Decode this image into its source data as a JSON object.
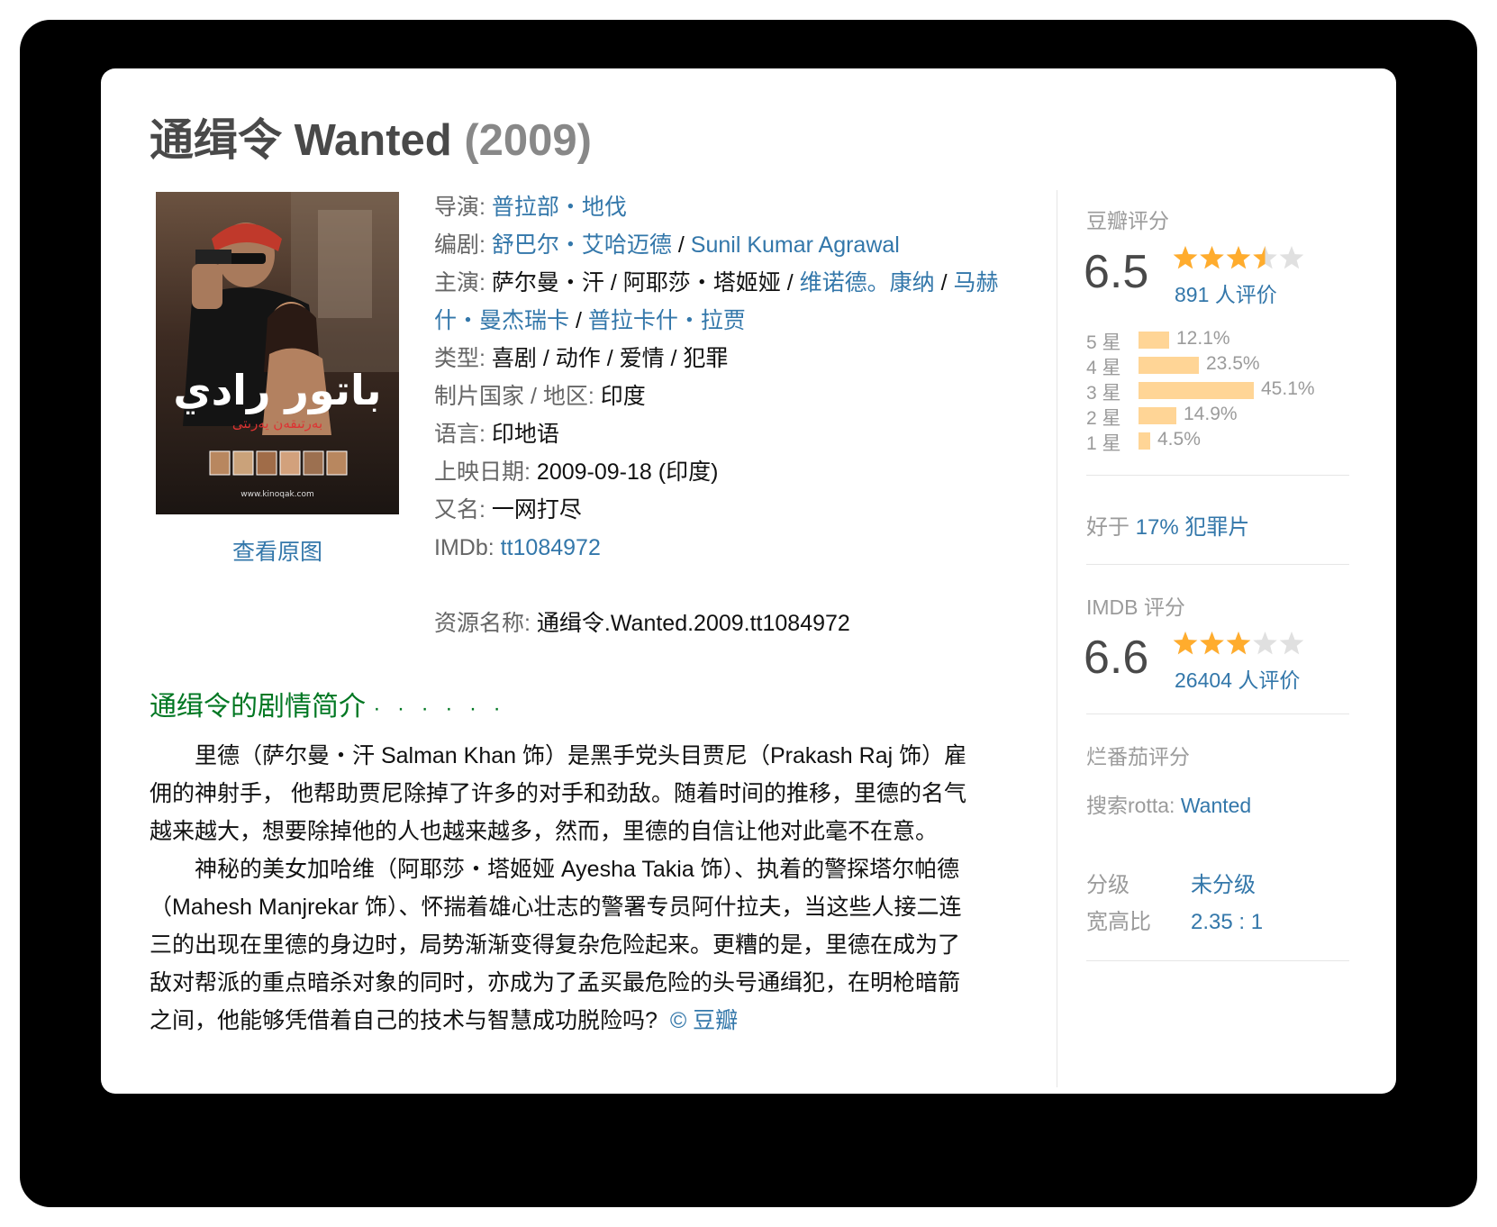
{
  "title": {
    "name": "通缉令 Wanted",
    "year": "(2009)"
  },
  "poster": {
    "view_original": "查看原图",
    "image_text": "www.kinoqak.com"
  },
  "info": {
    "director": {
      "label": "导演",
      "colon": ":",
      "names": [
        "普拉部・地伐"
      ]
    },
    "writer": {
      "label": "编剧",
      "colon": ":",
      "names": [
        "舒巴尔・艾哈迈德",
        "Sunil Kumar Agrawal"
      ]
    },
    "cast": {
      "label": "主演",
      "colon": ":",
      "names": [
        "萨尔曼・汗",
        "阿耶莎・塔姬娅",
        "维诺德。康纳",
        "马赫什・曼杰瑞卡",
        "普拉卡什・拉贾"
      ]
    },
    "genre": {
      "label": "类型",
      "colon": ":",
      "value": "喜剧 / 动作 / 爱情 / 犯罪"
    },
    "country": {
      "label": "制片国家 / 地区",
      "colon": ":",
      "value": "印度"
    },
    "language": {
      "label": "语言",
      "colon": ":",
      "value": "印地语"
    },
    "release": {
      "label": "上映日期",
      "colon": ":",
      "value": "2009-09-18 (印度)"
    },
    "aka": {
      "label": "又名",
      "colon": ":",
      "value": "一网打尽"
    },
    "imdb": {
      "label": "IMDb",
      "colon": ":",
      "value": "tt1084972"
    },
    "resource": {
      "label": "资源名称",
      "colon": ":",
      "value": "通缉令.Wanted.2009.tt1084972"
    },
    "separator": " / "
  },
  "summary": {
    "heading": "通缉令的剧情简介",
    "dots": "· · · · · ·",
    "paragraphs": [
      "里德（萨尔曼・汗 Salman Khan 饰）是黑手党头目贾尼（Prakash Raj 饰）雇佣的神射手， 他帮助贾尼除掉了许多的对手和劲敌。随着时间的推移，里德的名气越来越大，想要除掉他的人也越来越多，然而，里德的自信让他对此毫不在意。",
      "神秘的美女加哈维（阿耶莎・塔姬娅 Ayesha Takia 饰）、执着的警探塔尔帕德（Mahesh Manjrekar 饰）、怀揣着雄心壮志的警署专员阿什拉夫，当这些人接二连三的出现在里德的身边时，局势渐渐变得复杂危险起来。更糟的是，里德在成为了敌对帮派的重点暗杀对象的同时，亦成为了孟买最危险的头号通缉犯，在明枪暗箭之间，他能够凭借着自己的技术与智慧成功脱险吗?"
    ],
    "credit": "© 豆瓣"
  },
  "douban": {
    "label": "豆瓣评分",
    "score": "6.5",
    "stars": 3.5,
    "votes": "891 人评价",
    "distribution": [
      {
        "label": "5 星",
        "percent": 12.1,
        "text": "12.1%"
      },
      {
        "label": "4 星",
        "percent": 23.5,
        "text": "23.5%"
      },
      {
        "label": "3 星",
        "percent": 45.1,
        "text": "45.1%"
      },
      {
        "label": "2 星",
        "percent": 14.9,
        "text": "14.9%"
      },
      {
        "label": "1 星",
        "percent": 4.5,
        "text": "4.5%"
      }
    ],
    "better_prefix": "好于",
    "better_link": "17% 犯罪片"
  },
  "imdb_rating": {
    "label": "IMDB 评分",
    "score": "6.6",
    "stars": 3,
    "votes": "26404 人评价"
  },
  "rotten": {
    "label": "烂番茄评分",
    "search_prefix": "搜索rotta:",
    "search_link": "Wanted"
  },
  "meta": {
    "rating_label": "分级",
    "rating_value": "未分级",
    "aspect_label": "宽高比",
    "aspect_value": "2.35 : 1"
  },
  "colors": {
    "link": "#3377aa",
    "heading": "#007722",
    "star": "#ffac2d",
    "bar": "#ffd596"
  }
}
